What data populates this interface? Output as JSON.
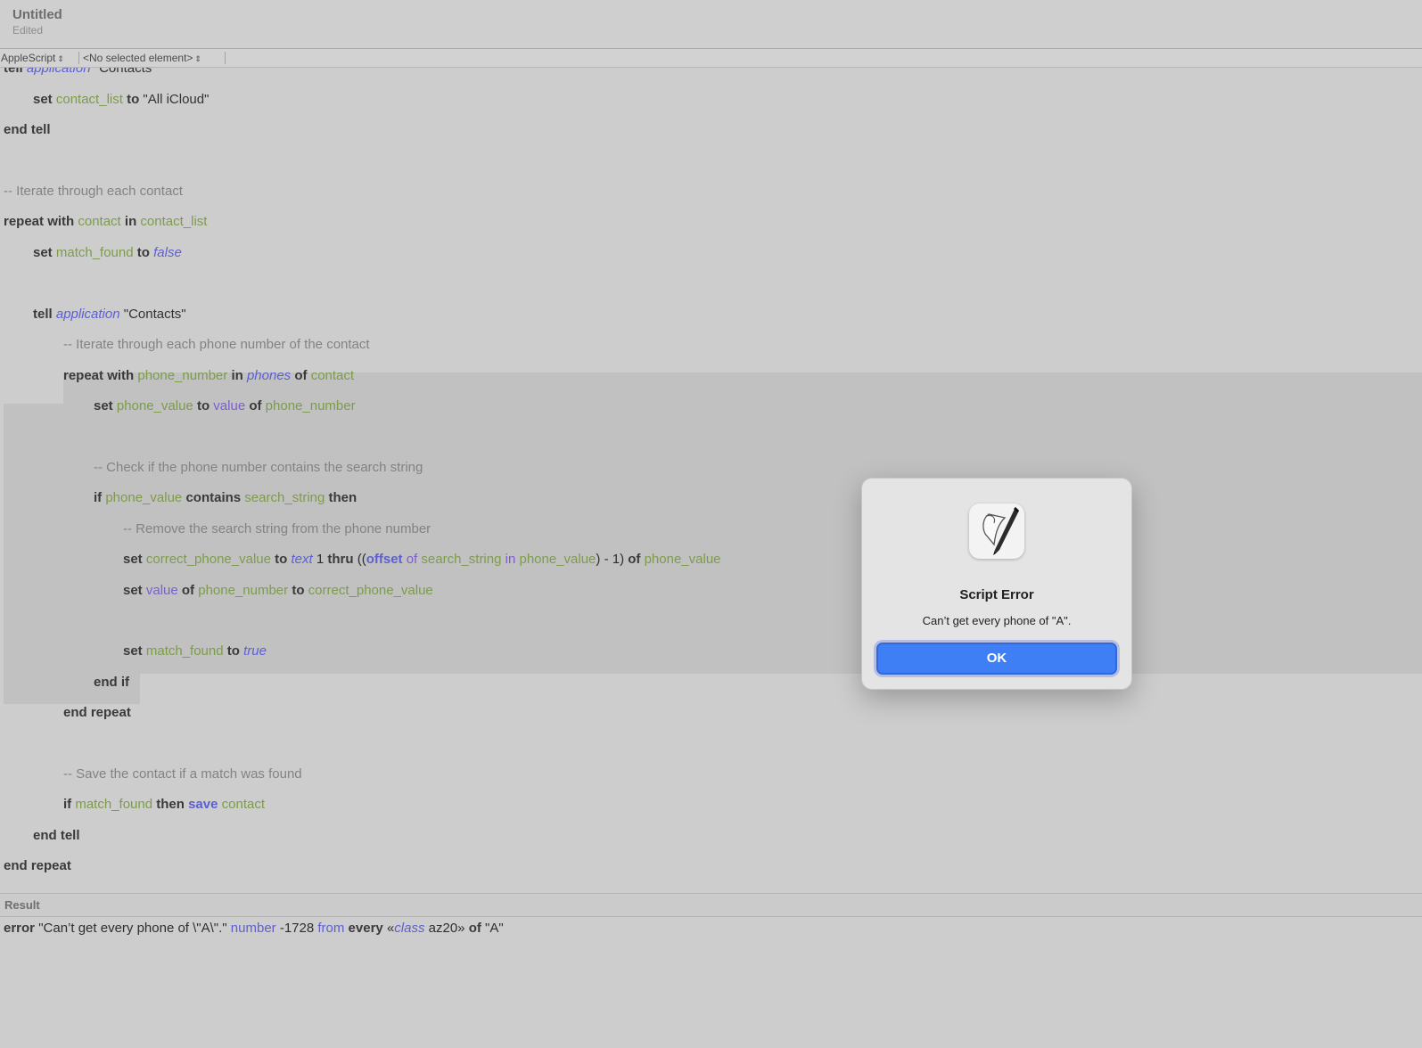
{
  "window": {
    "title": "Untitled",
    "status": "Edited"
  },
  "navigation": {
    "language": "AppleScript",
    "element": "<No selected element>"
  },
  "code": {
    "l0": {
      "tell": "tell",
      "cls": "application",
      "str": "\"Contacts\""
    },
    "l1": {
      "set": "set",
      "var": "contact_list",
      "to": "to",
      "str": "\"All iCloud\""
    },
    "l2": {
      "text": "end tell"
    },
    "l4": {
      "text": "-- Iterate through each contact"
    },
    "l5": {
      "repeat": "repeat with",
      "var": "contact",
      "in": "in",
      "var2": "contact_list"
    },
    "l6": {
      "set": "set",
      "var": "match_found",
      "to": "to",
      "val": "false"
    },
    "l8": {
      "tell": "tell",
      "cls": "application",
      "str": "\"Contacts\""
    },
    "l9": {
      "text": "-- Iterate through each phone number of the contact"
    },
    "l10": {
      "repeat": "repeat with",
      "var": "phone_number",
      "in": "in",
      "prop": "phones",
      "of": "of",
      "var2": "contact"
    },
    "l11": {
      "set": "set",
      "var": "phone_value",
      "to": "to",
      "prop": "value",
      "of": "of",
      "var2": "phone_number"
    },
    "l13": {
      "text": "-- Check if the phone number contains the search string"
    },
    "l14": {
      "if": "if",
      "var": "phone_value",
      "contains": "contains",
      "var2": "search_string",
      "then": "then"
    },
    "l15": {
      "text": "-- Remove the search string from the phone number"
    },
    "l16": {
      "set": "set",
      "var": "correct_phone_value",
      "to": "to",
      "cls": "text",
      "n1": "1",
      "thru": "thru",
      "paren": "((",
      "offset": "offset",
      "of1": "of",
      "var2": "search_string",
      "in": "in",
      "var3": "phone_value",
      "tail": ") - 1)",
      "of2": "of",
      "var4": "phone_value"
    },
    "l17": {
      "set": "set",
      "prop": "value",
      "of": "of",
      "var": "phone_number",
      "to": "to",
      "var2": "correct_phone_value"
    },
    "l19": {
      "set": "set",
      "var": "match_found",
      "to": "to",
      "val": "true"
    },
    "l20": {
      "text": "end if"
    },
    "l21": {
      "text": "end repeat"
    },
    "l23": {
      "text": "-- Save the contact if a match was found"
    },
    "l24": {
      "if": "if",
      "var": "match_found",
      "then": "then",
      "save": "save",
      "var2": "contact"
    },
    "l25": {
      "text": "end tell"
    },
    "l26": {
      "text": "end repeat"
    }
  },
  "result": {
    "label": "Result",
    "error_kw": "error",
    "message": "\"Can’t get every phone of \\\"A\\\".\"",
    "number_kw": "number",
    "number": "-1728",
    "from_kw": "from",
    "every_kw": "every",
    "open_q": "«",
    "class_kw": "class",
    "code": "az20»",
    "of_kw": "of",
    "obj": "\"A\""
  },
  "dialog": {
    "title": "Script Error",
    "message": "Can’t get every phone of \"A\".",
    "ok_label": "OK",
    "icon": "script-editor-icon"
  },
  "colors": {
    "accent": "#3f7ff6",
    "variable": "#7d9c4a",
    "class": "#5d5fd0",
    "comment": "#838383"
  }
}
